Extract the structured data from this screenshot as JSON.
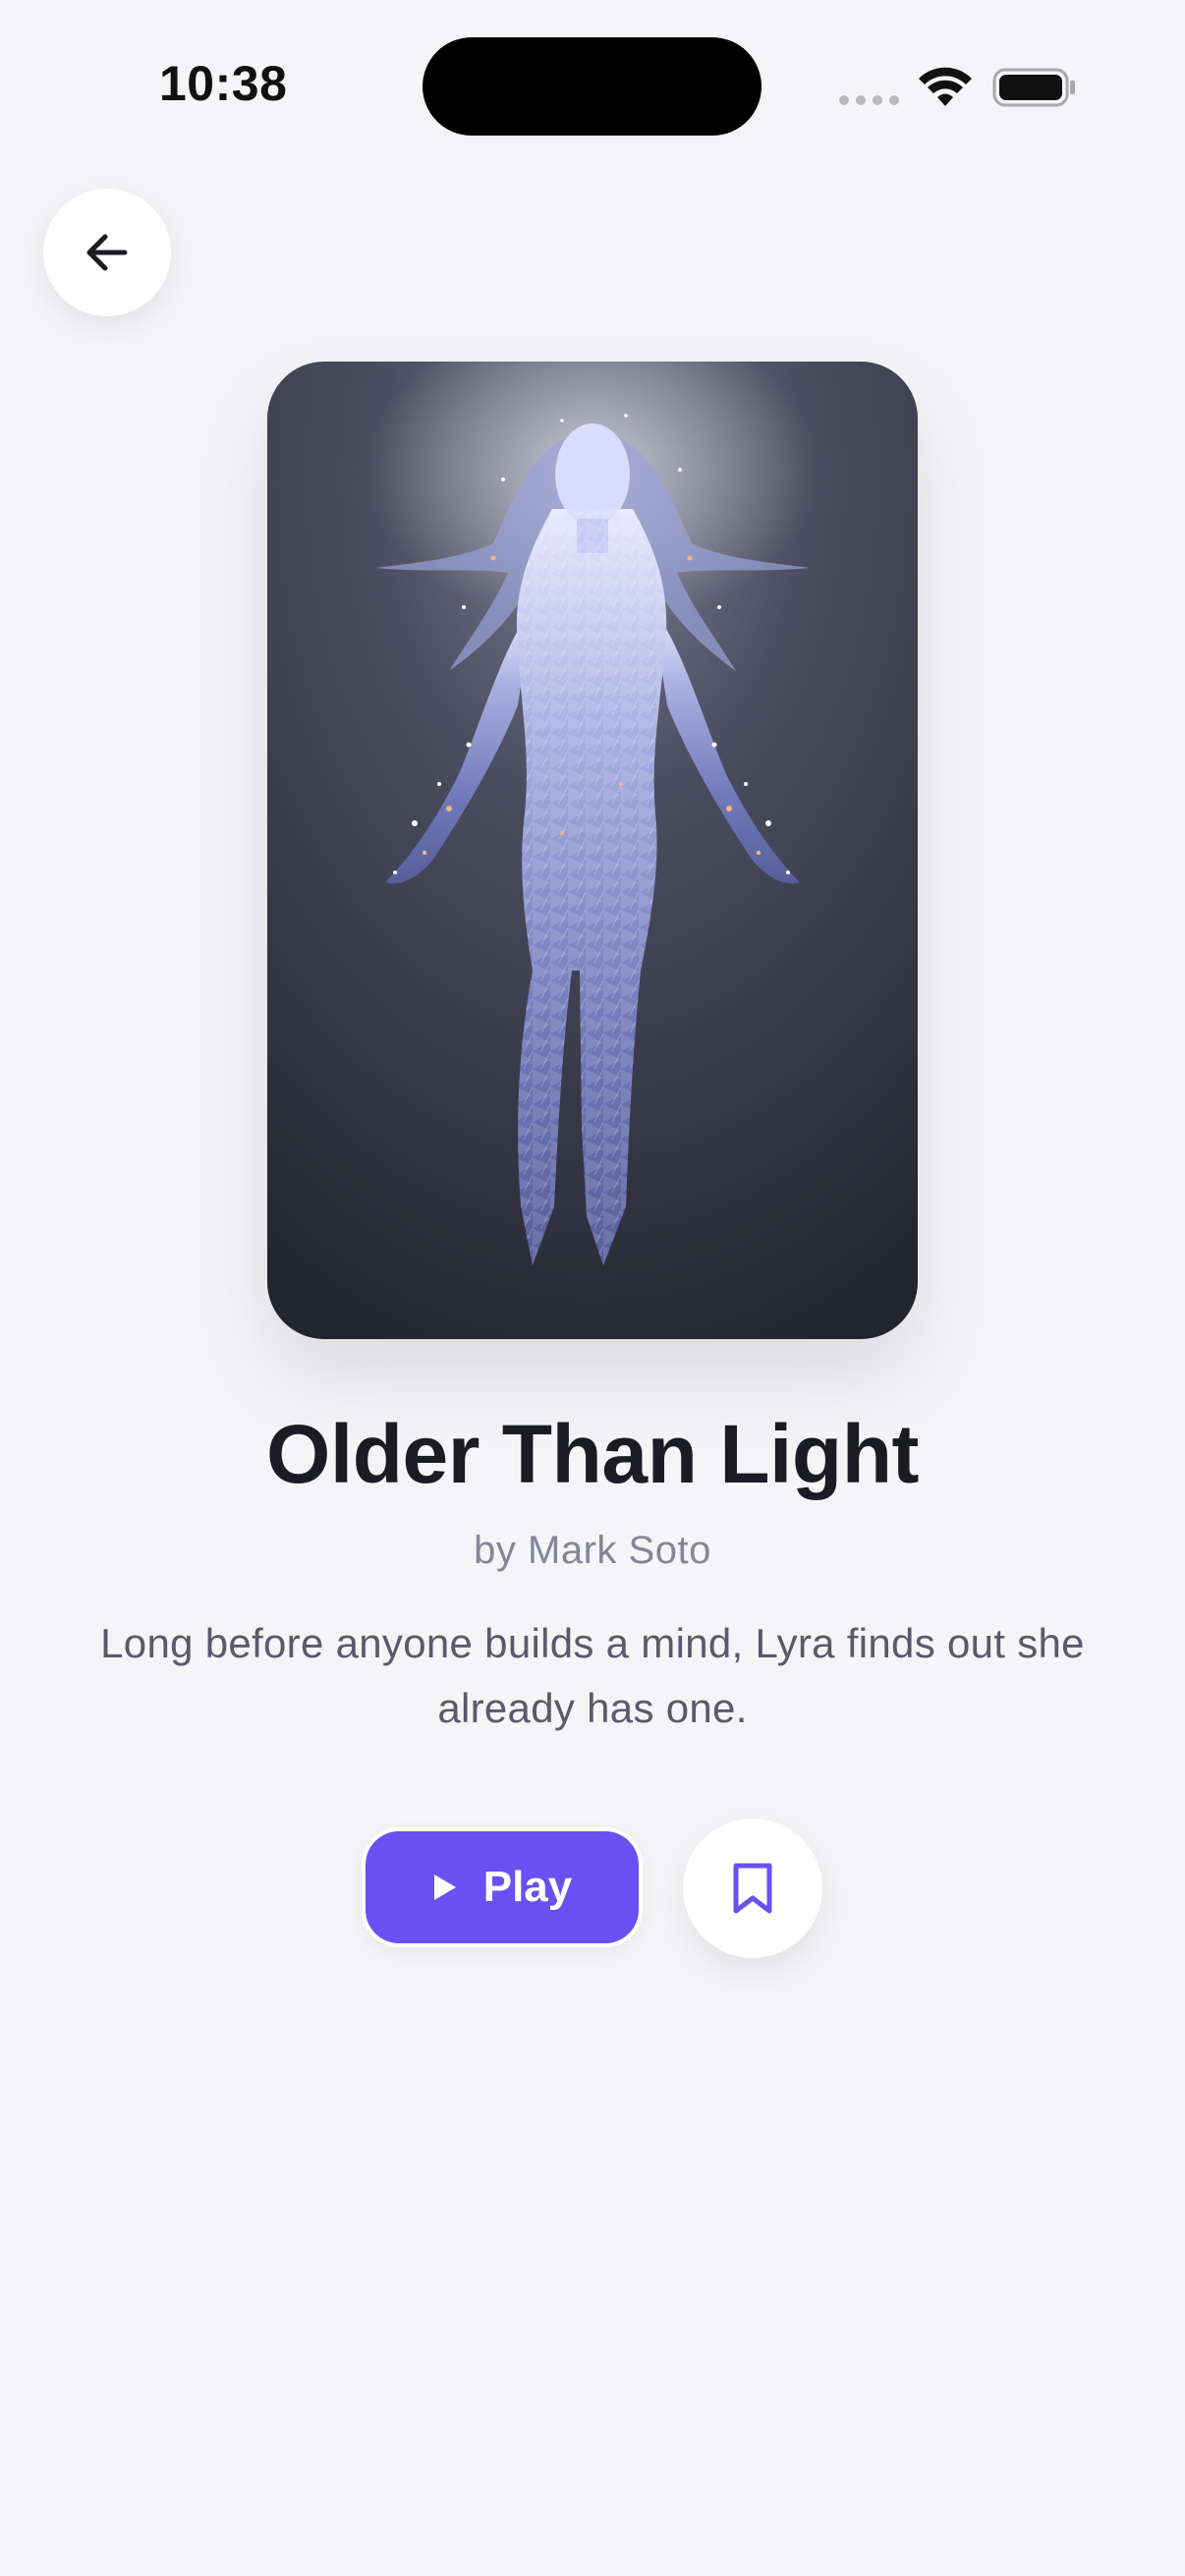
{
  "status_bar": {
    "time": "10:38"
  },
  "icons": {
    "back": "arrow-left-icon",
    "play": "play-icon",
    "bookmark": "bookmark-icon",
    "wifi": "wifi-icon",
    "battery": "battery-icon"
  },
  "story": {
    "title": "Older Than Light",
    "author": "by Mark Soto",
    "description": "Long before anyone builds a mind, Lyra finds out she already has one."
  },
  "actions": {
    "play_label": "Play"
  },
  "colors": {
    "accent": "#6a50f2",
    "background": "#f5f5f8",
    "title": "#1b1b24",
    "muted": "#85859a"
  }
}
